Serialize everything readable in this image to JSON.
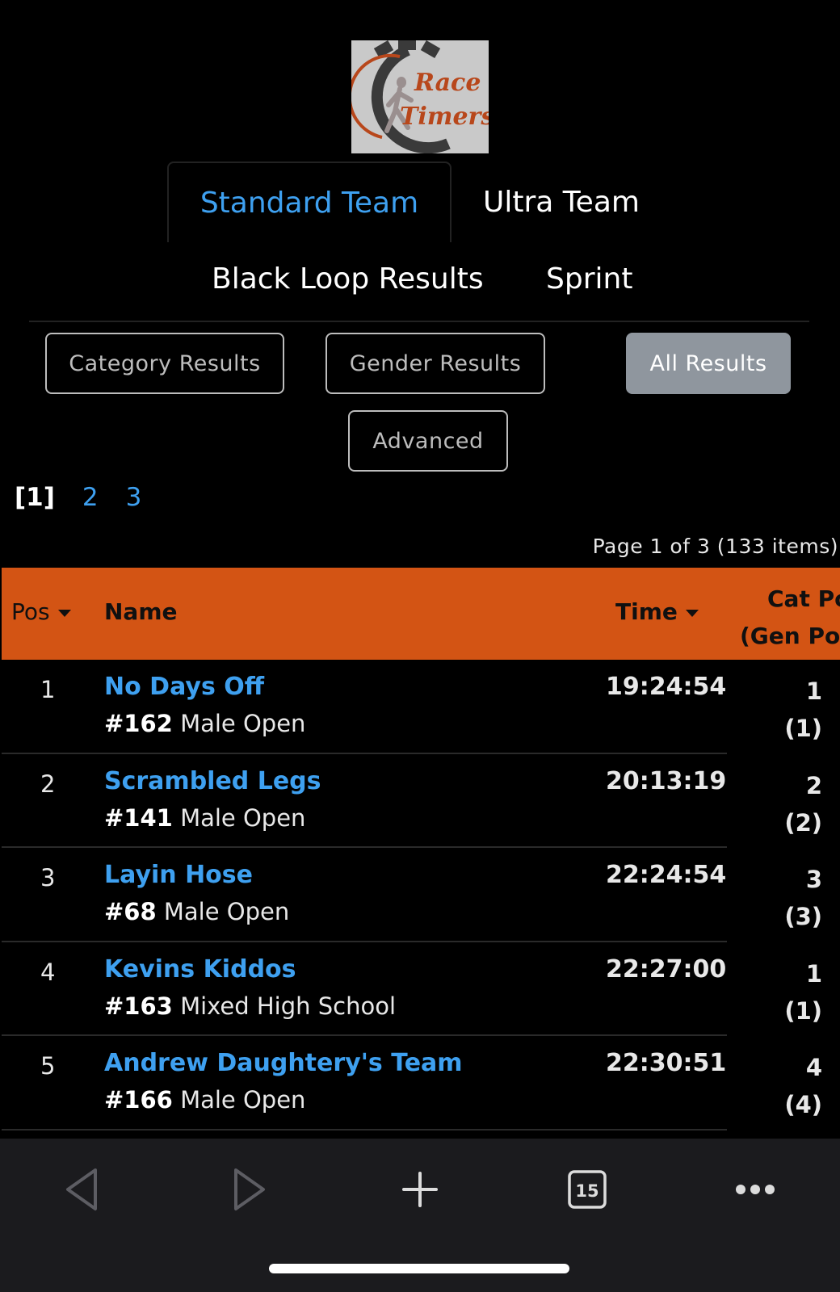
{
  "logo": {
    "line1": "Race",
    "line2": "Timers"
  },
  "tabs": [
    {
      "label": "Standard Team",
      "active": true
    },
    {
      "label": "Ultra Team",
      "active": false
    }
  ],
  "subtabs": [
    {
      "label": "Black Loop Results"
    },
    {
      "label": "Sprint"
    }
  ],
  "filters": {
    "category": "Category Results",
    "gender": "Gender Results",
    "all": "All Results",
    "advanced": "Advanced",
    "selected": "all"
  },
  "pager": {
    "current": "[1]",
    "pages": [
      "2",
      "3"
    ]
  },
  "page_info": "Page 1 of 3 (133 items)",
  "table": {
    "headers": {
      "pos": "Pos",
      "name": "Name",
      "time": "Time",
      "cat_line1": "Cat Po",
      "cat_line2": "(Gen Pos"
    },
    "rows": [
      {
        "pos": "1",
        "name": "No Days Off",
        "bib": "#162",
        "category": "Male Open",
        "time": "19:24:54",
        "cat_pos": "1",
        "gen_pos": "(1)"
      },
      {
        "pos": "2",
        "name": "Scrambled Legs",
        "bib": "#141",
        "category": "Male Open",
        "time": "20:13:19",
        "cat_pos": "2",
        "gen_pos": "(2)"
      },
      {
        "pos": "3",
        "name": "Layin Hose",
        "bib": "#68",
        "category": "Male Open",
        "time": "22:24:54",
        "cat_pos": "3",
        "gen_pos": "(3)"
      },
      {
        "pos": "4",
        "name": "Kevins Kiddos",
        "bib": "#163",
        "category": "Mixed High School",
        "time": "22:27:00",
        "cat_pos": "1",
        "gen_pos": "(1)"
      },
      {
        "pos": "5",
        "name": "Andrew Daughtery's Team",
        "bib": "#166",
        "category": "Male Open",
        "time": "22:30:51",
        "cat_pos": "4",
        "gen_pos": "(4)"
      }
    ]
  },
  "toolbar": {
    "back": "back-icon",
    "forward": "forward-icon",
    "new_tab": "plus-icon",
    "tab_count": "15",
    "more": "more-icon"
  },
  "colors": {
    "accent": "#3ea0f0",
    "header": "#d35414",
    "selected_button": "#8f969e"
  }
}
